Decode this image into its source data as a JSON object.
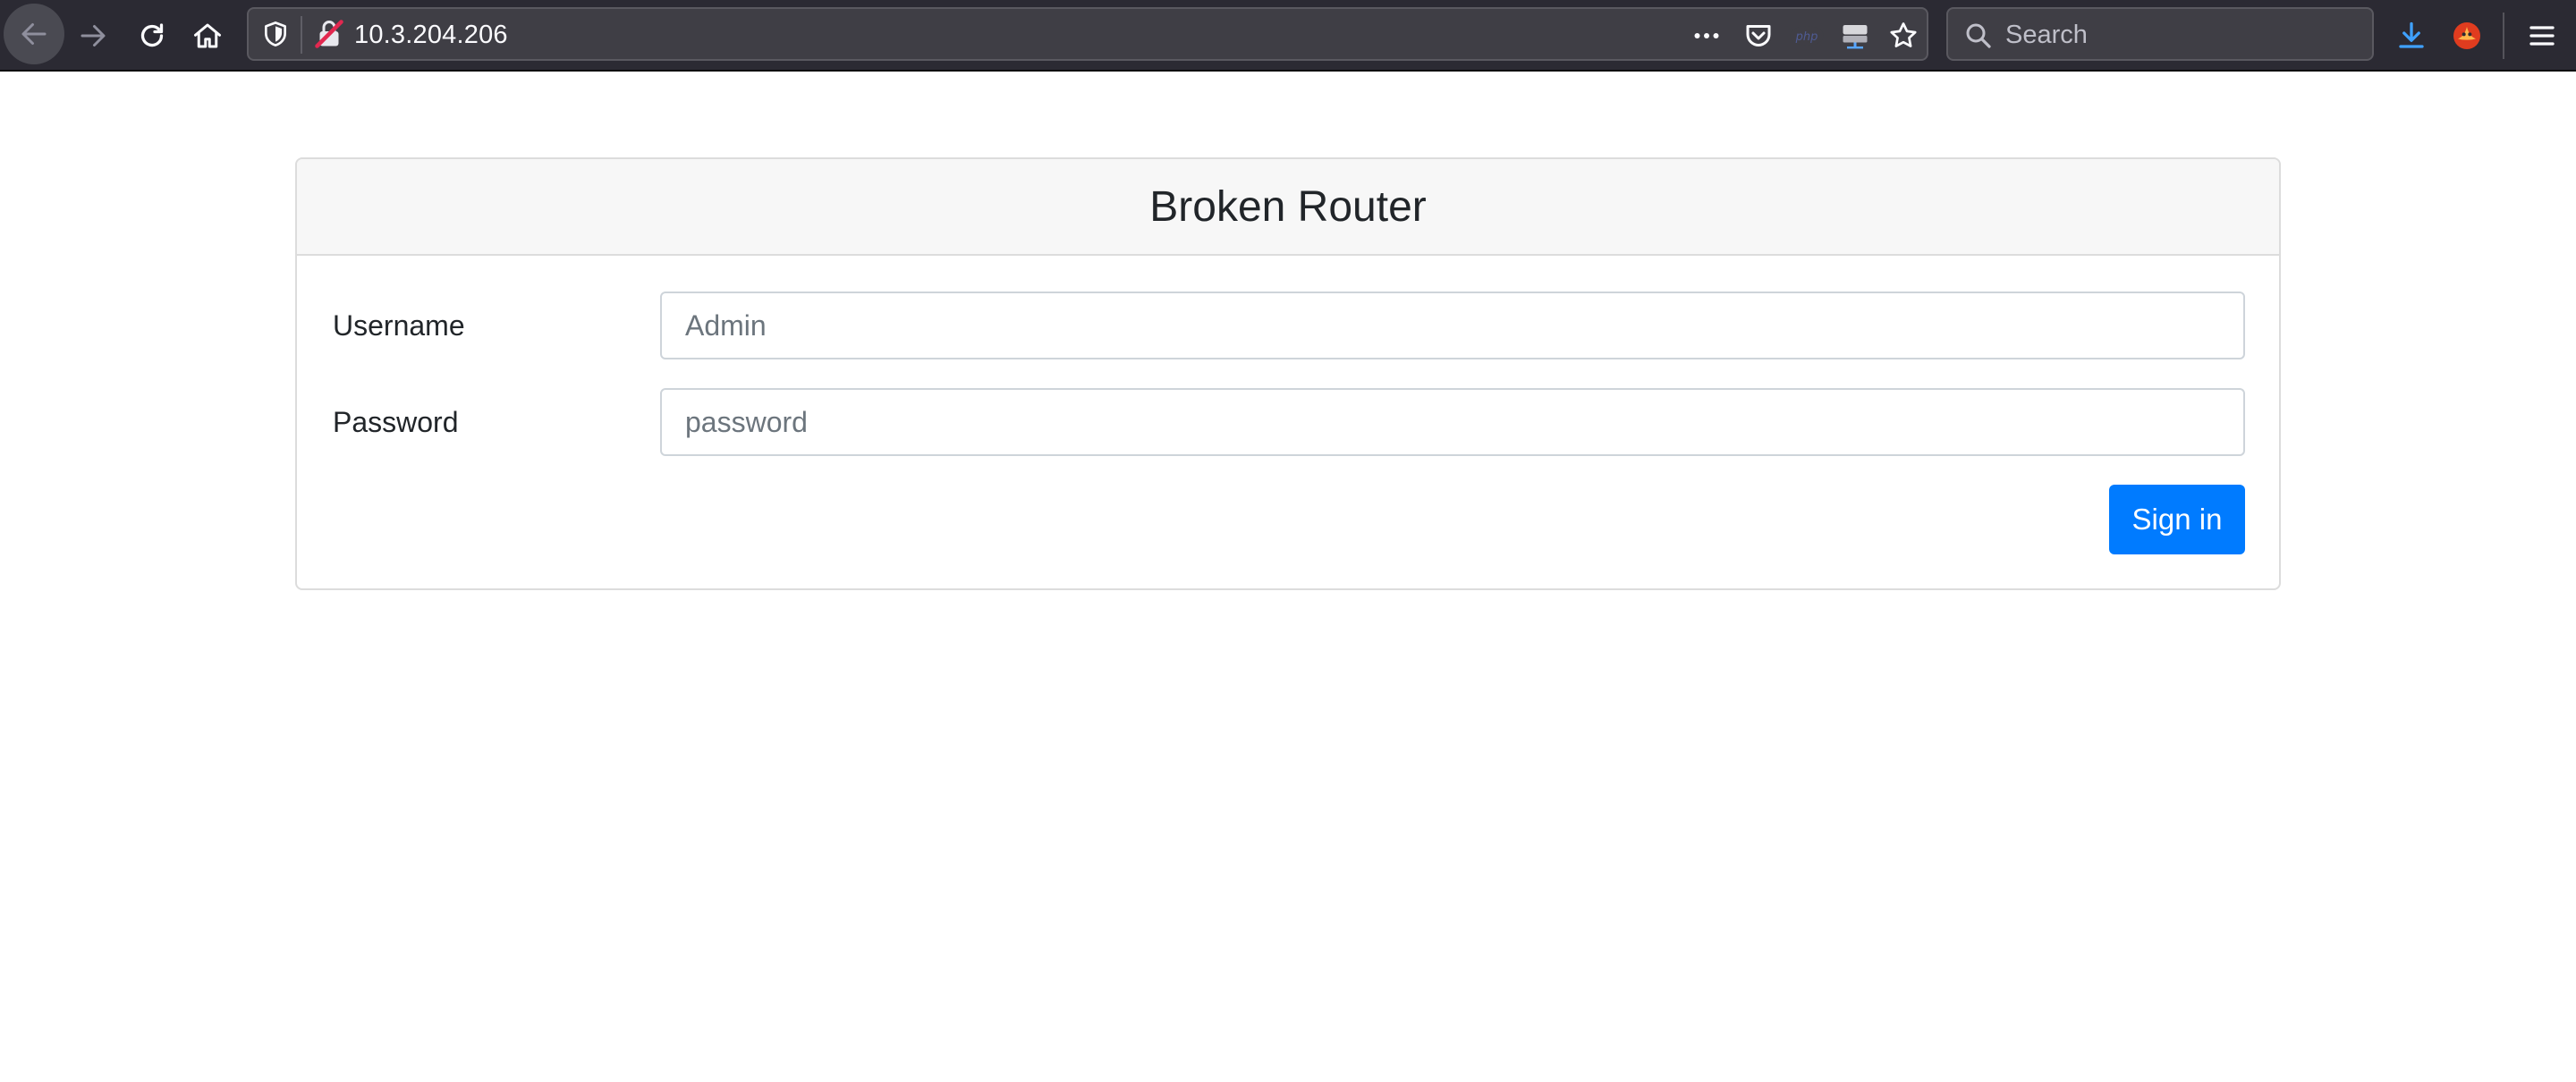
{
  "browser": {
    "url": "10.3.204.206",
    "search_placeholder": "Search",
    "icons": [
      "back-icon",
      "forward-icon",
      "reload-icon",
      "home-icon",
      "shield-icon",
      "insecure-lock-icon",
      "more-icon",
      "pocket-icon",
      "php-icon",
      "server-icon",
      "star-icon",
      "search-icon",
      "download-icon",
      "extension-icon",
      "hamburger-menu-icon"
    ],
    "url_php_label": "php"
  },
  "page": {
    "title": "Broken Router",
    "form": {
      "username_label": "Username",
      "username_placeholder": "Admin",
      "username_value": "",
      "password_label": "Password",
      "password_placeholder": "password",
      "password_value": "",
      "submit_label": "Sign in"
    }
  },
  "colors": {
    "primary": "#007bff",
    "toolbar": "#2b2a33",
    "header_bg": "#f7f7f7",
    "border": "#dcdcdc"
  }
}
